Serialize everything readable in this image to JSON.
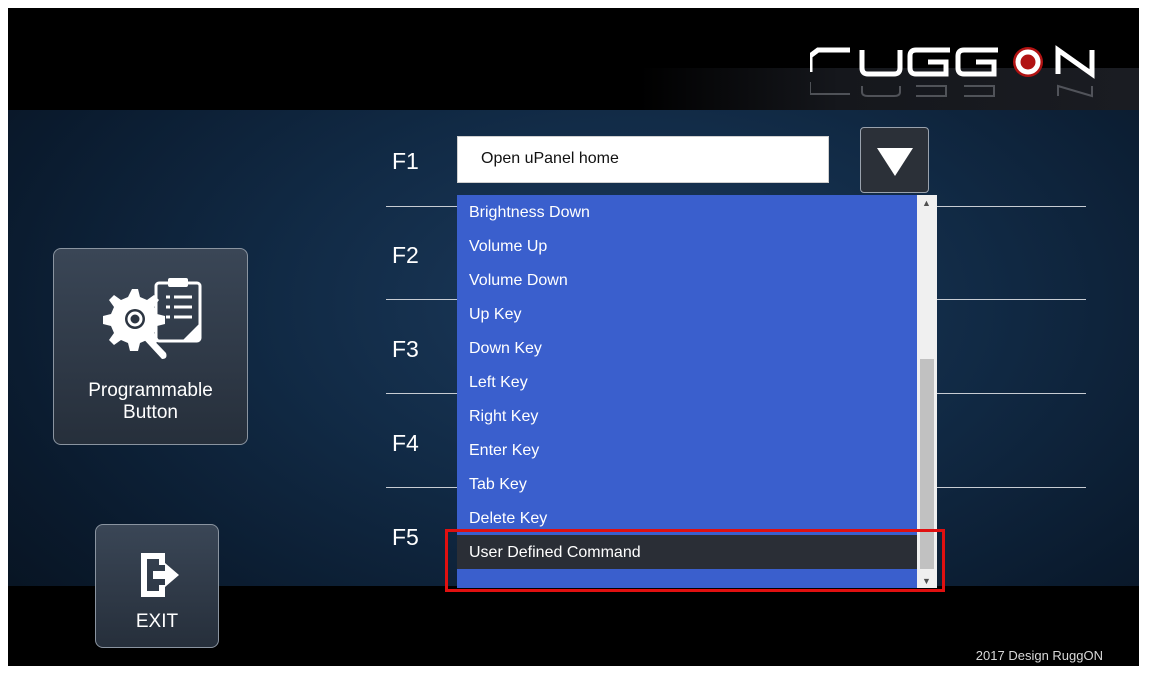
{
  "brand": {
    "logo_text": "RUGGON"
  },
  "sidebar": {
    "programmable_label_line1": "Programmable",
    "programmable_label_line2": "Button",
    "exit_label": "EXIT"
  },
  "keys": {
    "f1": "F1",
    "f2": "F2",
    "f3": "F3",
    "f4": "F4",
    "f5": "F5"
  },
  "f1_field": {
    "value": "Open uPanel home"
  },
  "dropdown": {
    "options": [
      "Brightness Down",
      "Volume Up",
      "Volume Down",
      "Up Key",
      "Down Key",
      "Left Key",
      "Right Key",
      "Enter Key",
      "Tab Key",
      "Delete Key",
      "User Defined Command"
    ],
    "selected": "User Defined Command"
  },
  "footer": {
    "text": "2017 Design RuggON"
  },
  "colors": {
    "dropdown_bg": "#3a5fcd",
    "selected_bg": "#2a2e36",
    "highlight": "#e01010"
  }
}
